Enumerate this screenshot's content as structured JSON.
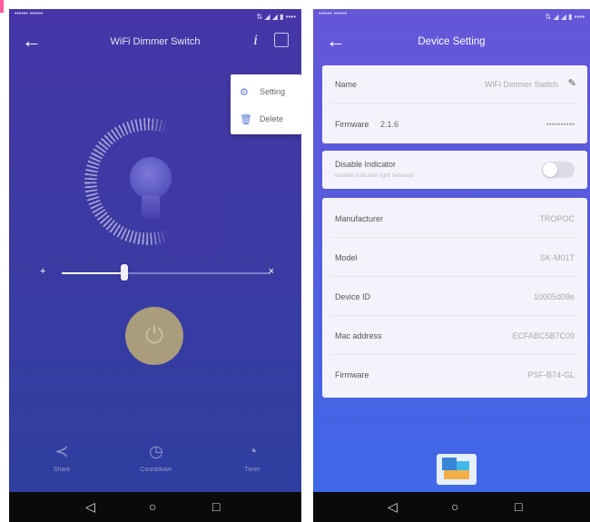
{
  "left_screen": {
    "status": {
      "carrier": "•••••• ••••••",
      "icons": "⇅ ◢ ◢ ▮ ••••"
    },
    "title": "WiFi Dimmer Switch",
    "info_glyph": "i",
    "menu": [
      {
        "icon": "gear-icon",
        "glyph": "⚙",
        "label": "Setting"
      },
      {
        "icon": "trash-icon",
        "glyph": "🗑",
        "label": "Delete"
      }
    ],
    "brightness_level_percent": 30,
    "slider_minus": "+",
    "slider_plus": "×",
    "power_glyph": "⏻",
    "bottom_nav": [
      {
        "icon": "share-icon",
        "glyph": "≺",
        "label": "Share"
      },
      {
        "icon": "countdown-icon",
        "glyph": "◷",
        "label": "Countdown"
      },
      {
        "icon": "timer-icon",
        "glyph": "◔",
        "label": "Timer"
      }
    ]
  },
  "right_screen": {
    "status": {
      "carrier": "•••••• ••••••",
      "icons": "⇅ ◢ ◢ ▮ ••••"
    },
    "title": "Device Setting",
    "card1": {
      "name_label": "Name",
      "name_value": "WiFi Dimmer Switch",
      "firmware_label": "Firmware",
      "firmware_value": "2.1.6",
      "firmware_extra": "••••••••••"
    },
    "card2": {
      "label": "Disable Indicator",
      "sublabel": "disable indicator light behavior",
      "enabled": false
    },
    "card3": [
      {
        "label": "Manufacturer",
        "value": "TROPOC"
      },
      {
        "label": "Model",
        "value": "SK-M01T"
      },
      {
        "label": "Device ID",
        "value": "10005d09e"
      },
      {
        "label": "Mac address",
        "value": "ECFABC5B7C09"
      },
      {
        "label": "Firmware",
        "value": "PSF-B74-GL"
      }
    ]
  },
  "android_nav": {
    "back": "◁",
    "home": "○",
    "recents": "□"
  },
  "colors": {
    "accent": "#5a7bd8",
    "power": "#aa9d7c"
  }
}
